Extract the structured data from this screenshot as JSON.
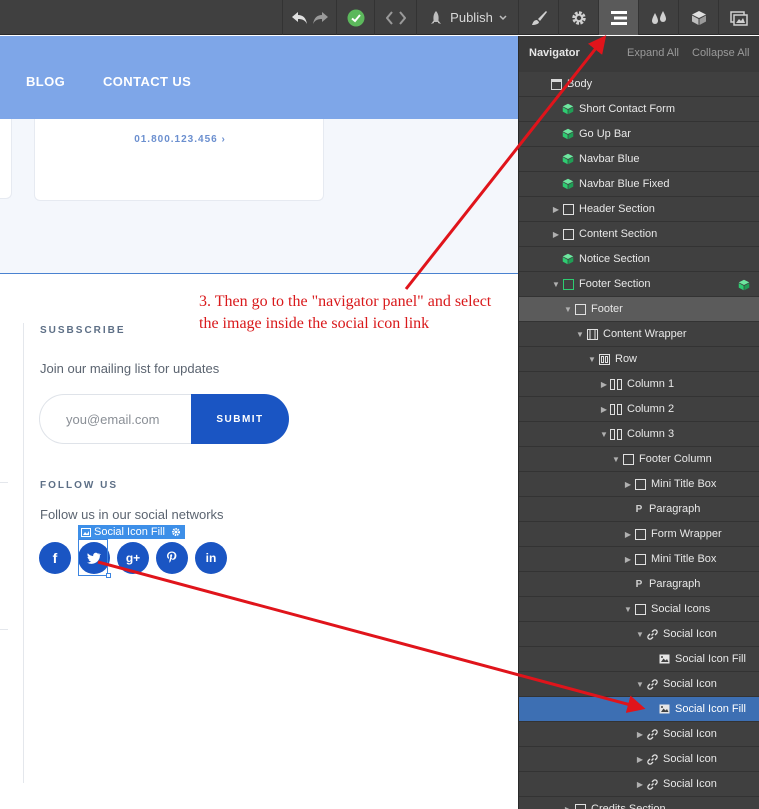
{
  "toolbar": {
    "publish_label": "Publish"
  },
  "site": {
    "nav_links": [
      "BLOG",
      "CONTACT US"
    ],
    "phone": "01.800.123.456 ›",
    "subscribe_label": "SUSBSCRIBE",
    "mailing_text": "Join our mailing list for updates",
    "email_placeholder": "you@email.com",
    "submit_label": "SUBMIT",
    "follow_label": "FOLLOW US",
    "follow_text": "Follow us in our social networks",
    "selection_tag": "Social Icon Fill"
  },
  "navigator": {
    "title": "Navigator",
    "expand_all": "Expand All",
    "collapse_all": "Collapse All",
    "items": [
      {
        "label": "Body",
        "indent": 0,
        "caret": "none",
        "icon": "page"
      },
      {
        "label": "Short Contact Form",
        "indent": 1,
        "caret": "none",
        "icon": "symbol"
      },
      {
        "label": "Go Up Bar",
        "indent": 1,
        "caret": "none",
        "icon": "symbol"
      },
      {
        "label": "Navbar Blue",
        "indent": 1,
        "caret": "none",
        "icon": "symbol"
      },
      {
        "label": "Navbar Blue Fixed",
        "indent": 1,
        "caret": "none",
        "icon": "symbol"
      },
      {
        "label": "Header Section",
        "indent": 1,
        "caret": "right",
        "icon": "box"
      },
      {
        "label": "Content Section",
        "indent": 1,
        "caret": "right",
        "icon": "box"
      },
      {
        "label": "Notice Section",
        "indent": 1,
        "caret": "none",
        "icon": "symbol"
      },
      {
        "label": "Footer Section",
        "indent": 1,
        "caret": "down",
        "icon": "box-green",
        "badge": true
      },
      {
        "label": "Footer",
        "indent": 2,
        "caret": "down",
        "icon": "box",
        "active": true
      },
      {
        "label": "Content Wrapper",
        "indent": 3,
        "caret": "down",
        "icon": "container"
      },
      {
        "label": "Row",
        "indent": 4,
        "caret": "down",
        "icon": "row"
      },
      {
        "label": "Column 1",
        "indent": 5,
        "caret": "right",
        "icon": "column"
      },
      {
        "label": "Column 2",
        "indent": 5,
        "caret": "right",
        "icon": "column"
      },
      {
        "label": "Column 3",
        "indent": 5,
        "caret": "down",
        "icon": "column"
      },
      {
        "label": "Footer Column",
        "indent": 6,
        "caret": "down",
        "icon": "box"
      },
      {
        "label": "Mini Title Box",
        "indent": 7,
        "caret": "right",
        "icon": "box"
      },
      {
        "label": "Paragraph",
        "indent": 7,
        "caret": "none",
        "icon": "p"
      },
      {
        "label": "Form Wrapper",
        "indent": 7,
        "caret": "right",
        "icon": "box"
      },
      {
        "label": "Mini Title Box",
        "indent": 7,
        "caret": "right",
        "icon": "box"
      },
      {
        "label": "Paragraph",
        "indent": 7,
        "caret": "none",
        "icon": "p"
      },
      {
        "label": "Social Icons",
        "indent": 7,
        "caret": "down",
        "icon": "box"
      },
      {
        "label": "Social Icon",
        "indent": 8,
        "caret": "down",
        "icon": "link"
      },
      {
        "label": "Social Icon Fill",
        "indent": 9,
        "caret": "none",
        "icon": "image"
      },
      {
        "label": "Social Icon",
        "indent": 8,
        "caret": "down",
        "icon": "link"
      },
      {
        "label": "Social Icon Fill",
        "indent": 9,
        "caret": "none",
        "icon": "image",
        "selected": true
      },
      {
        "label": "Social Icon",
        "indent": 8,
        "caret": "right",
        "icon": "link"
      },
      {
        "label": "Social Icon",
        "indent": 8,
        "caret": "right",
        "icon": "link"
      },
      {
        "label": "Social Icon",
        "indent": 8,
        "caret": "right",
        "icon": "link"
      },
      {
        "label": "Credits Section",
        "indent": 2,
        "caret": "right",
        "icon": "box"
      }
    ]
  },
  "annotation": {
    "text": "3. Then go to the \"navigator panel\" and select the image inside the social icon link"
  },
  "colors": {
    "annotation_red": "#d9191b",
    "symbol_green": "#2ecc71",
    "brand_blue": "#1a55c3",
    "nav_blue": "#7ea6e8",
    "selected_row": "#3d6fb3"
  }
}
